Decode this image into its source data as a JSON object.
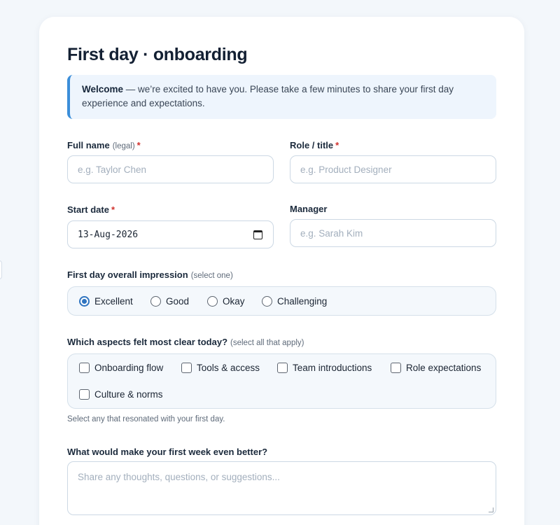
{
  "form": {
    "title": "First day · onboarding",
    "notice": {
      "bold": "Welcome",
      "text": " — we’re excited to have you. Please take a few minutes to share your first day experience and expectations."
    },
    "full_name": {
      "label": "Full name",
      "hint": "(legal)",
      "required": "*",
      "placeholder": "e.g. Taylor Chen"
    },
    "role": {
      "label": "Role / title",
      "required": "*",
      "placeholder": "e.g. Product Designer"
    },
    "start_date": {
      "label": "Start date",
      "required": "*",
      "value": "13-Aug-2026"
    },
    "manager": {
      "label": "Manager",
      "placeholder": "e.g. Sarah Kim"
    },
    "impression": {
      "label": "First day overall impression",
      "hint": "(select one)",
      "options": [
        "Excellent",
        "Good",
        "Okay",
        "Challenging"
      ],
      "selected": "Excellent"
    },
    "aspects": {
      "label": "Which aspects felt most clear today?",
      "hint": "(select all that apply)",
      "options": [
        "Onboarding flow",
        "Tools & access",
        "Team introductions",
        "Role expectations",
        "Culture & norms"
      ],
      "helper": "Select any that resonated with your first day."
    },
    "improve": {
      "label": "What would make your first week even better?",
      "placeholder": "Share any thoughts, questions, or suggestions..."
    }
  }
}
